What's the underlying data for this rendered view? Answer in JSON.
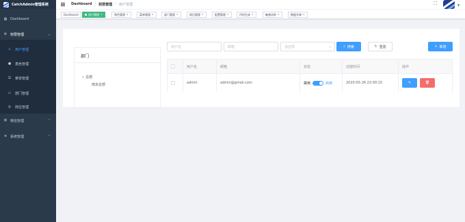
{
  "app": {
    "title": "CatchAdmin管理系统"
  },
  "sidebar": {
    "items": [
      {
        "label": "Dashboard",
        "icon": "dashboard-icon"
      },
      {
        "label": "权限管理",
        "icon": "gear-icon"
      },
      {
        "label": "用户管理",
        "icon": "user-icon"
      },
      {
        "label": "角色管理",
        "icon": "person-icon"
      },
      {
        "label": "菜单管理",
        "icon": "menu-icon"
      },
      {
        "label": "部门管理",
        "icon": "monitor-icon"
      },
      {
        "label": "岗位管理",
        "icon": "post-icon"
      },
      {
        "label": "微信管理",
        "icon": "wechat-icon"
      },
      {
        "label": "系统管理",
        "icon": "settings-icon"
      }
    ]
  },
  "header": {
    "breadcrumb": [
      "Dashboard",
      "权限管理",
      "用户管理"
    ]
  },
  "tags": [
    {
      "label": "Dashboard"
    },
    {
      "label": "用户管理"
    },
    {
      "label": "角色管理"
    },
    {
      "label": "菜单管理"
    },
    {
      "label": "部门管理"
    },
    {
      "label": "岗位管理"
    },
    {
      "label": "配置管理"
    },
    {
      "label": "代码生成"
    },
    {
      "label": "敏感词库"
    },
    {
      "label": "数据字典"
    }
  ],
  "dept_panel": {
    "title": "部门",
    "tree": [
      "总部",
      "南京总部"
    ]
  },
  "filters": {
    "username_placeholder": "用户名",
    "email_placeholder": "邮箱",
    "status_placeholder": "请选择",
    "search_label": "搜索",
    "reset_label": "重置",
    "add_label": "新增"
  },
  "table": {
    "columns": [
      "用户名",
      "邮箱",
      "状态",
      "创建时间",
      "操作"
    ],
    "rows": [
      {
        "username": "admin",
        "email": "admin@gmail.com",
        "status_off": "禁用",
        "status_on": "启用",
        "enabled": true,
        "created_at": "2020-05-26 22:00:15"
      }
    ]
  },
  "colors": {
    "sidebar_bg": "#2b3a4a",
    "accent": "#409eff",
    "active_tag": "#42b983",
    "danger": "#f56c6c"
  }
}
